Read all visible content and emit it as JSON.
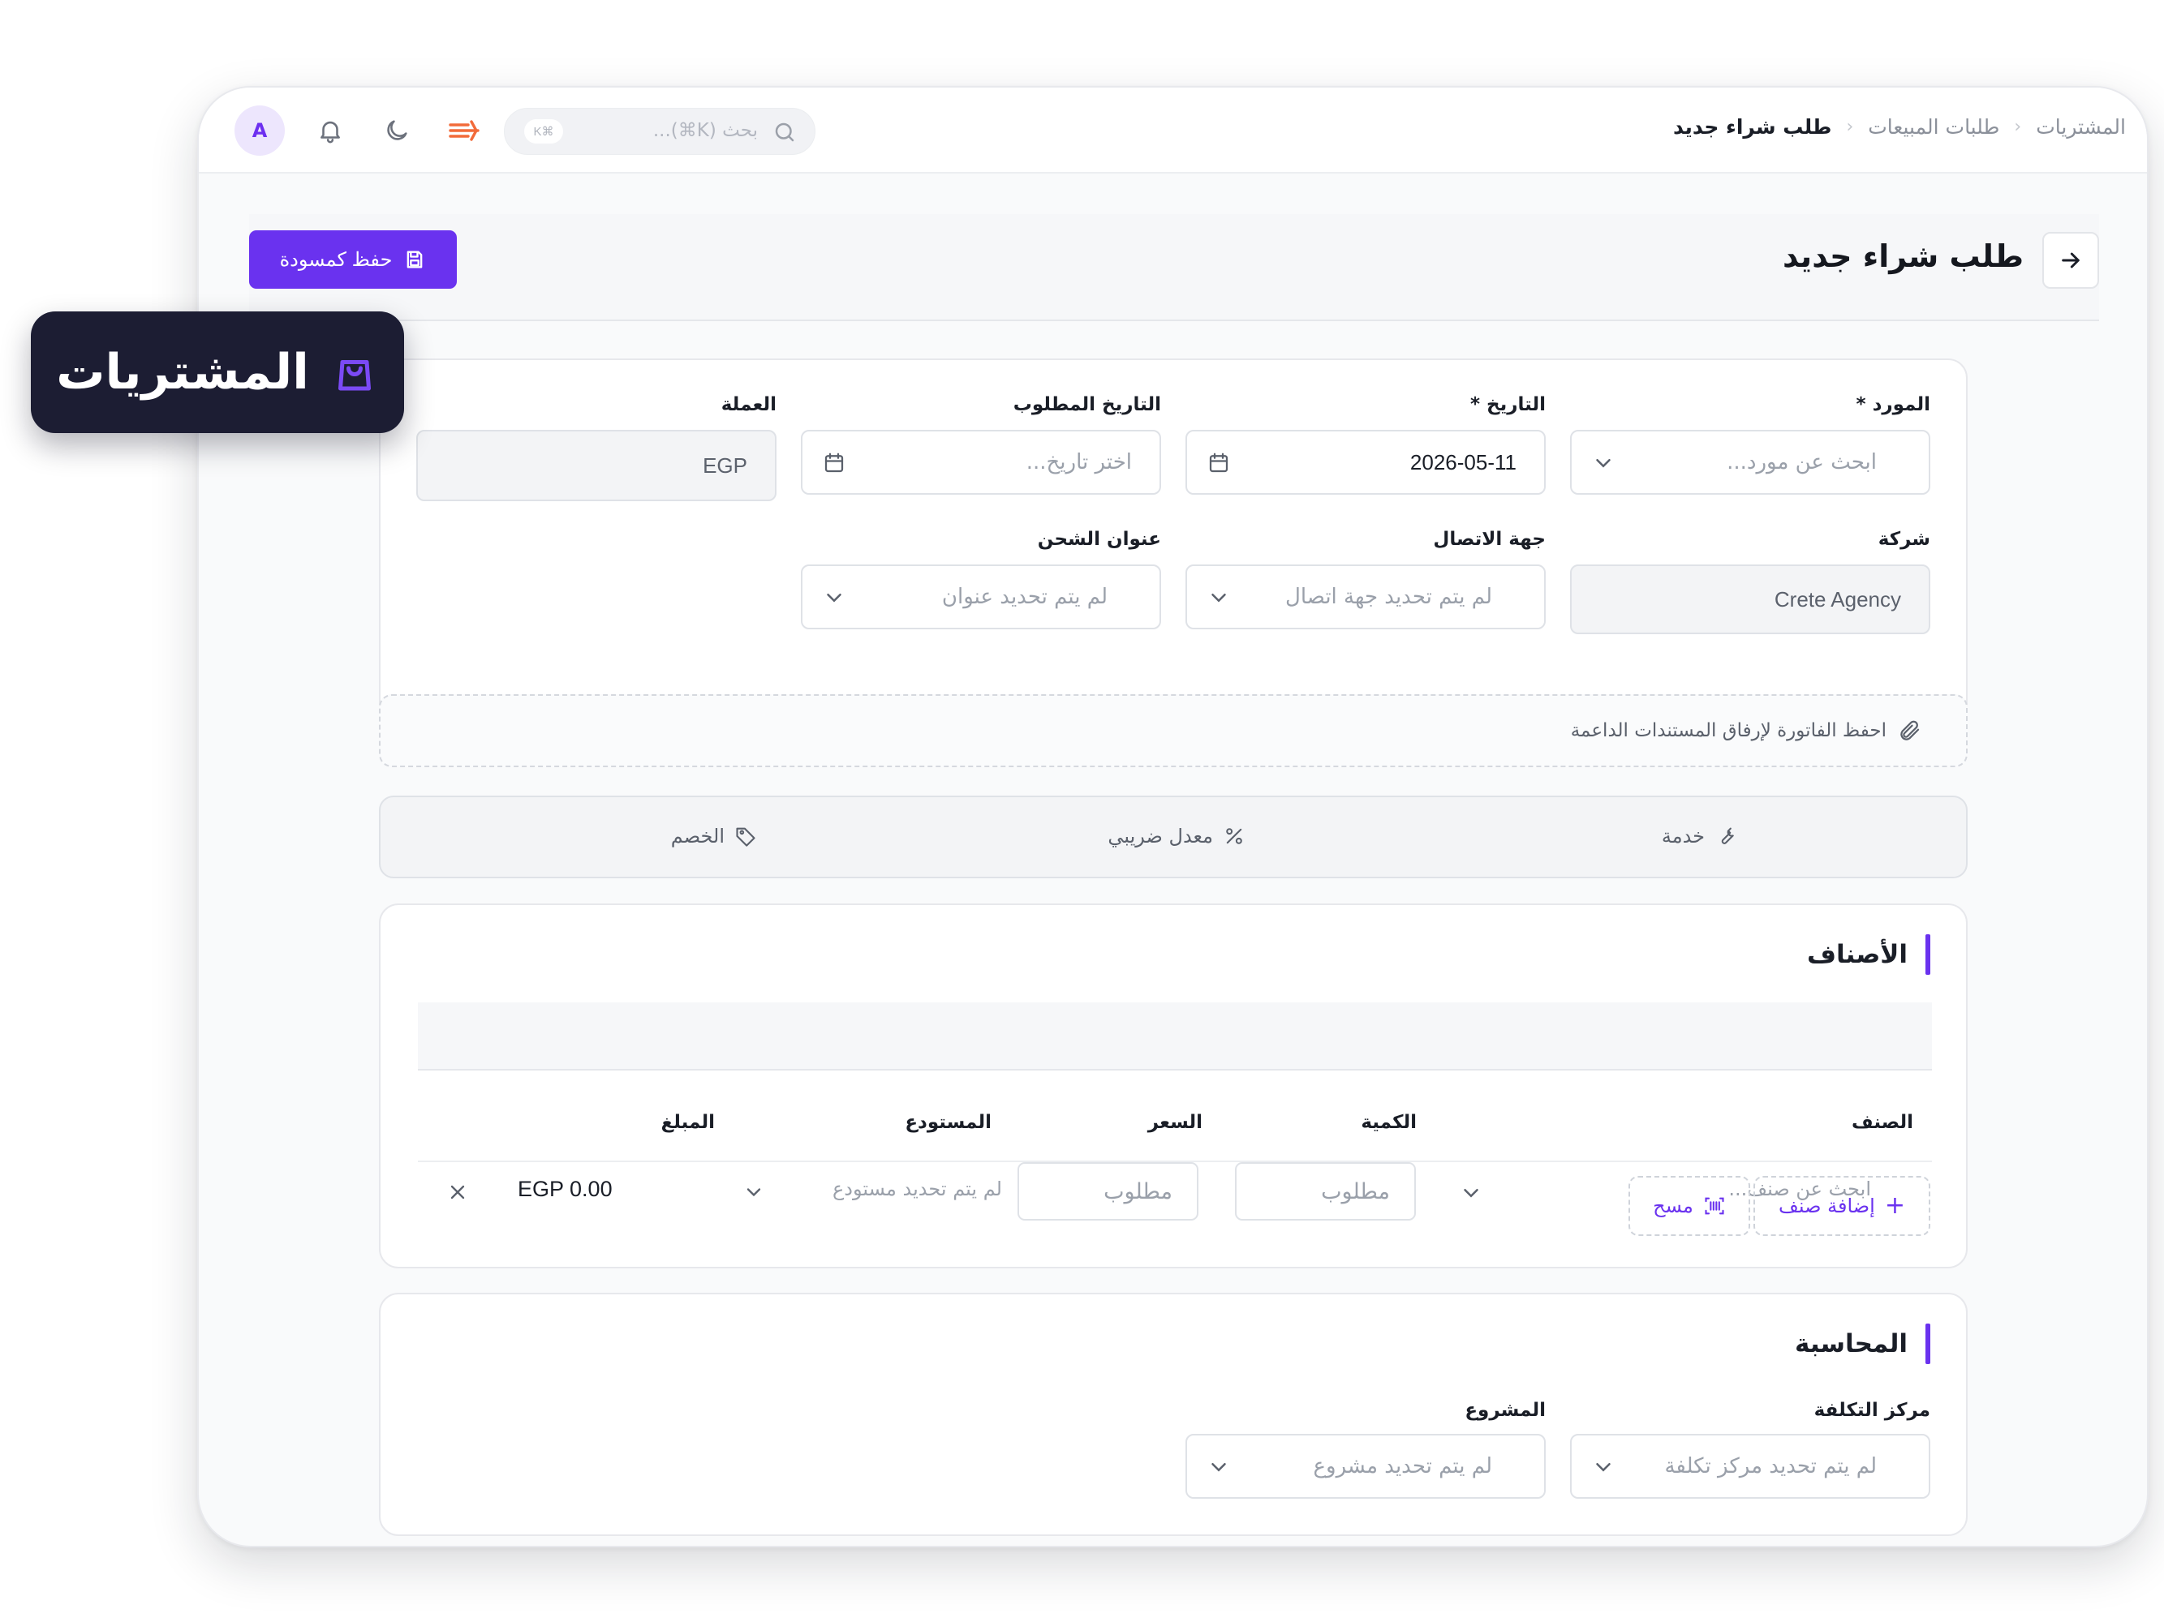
{
  "badge": {
    "label": "المشتريات",
    "icon": "shopping-bag-icon"
  },
  "topbar": {
    "avatar_initial": "A",
    "search_placeholder": "بحث (K⌘)...",
    "search_shortcut": "K⌘",
    "icons": [
      "search-icon",
      "bell-icon",
      "moon-icon",
      "brand-logo-icon"
    ]
  },
  "breadcrumb": {
    "items": [
      "المشتريات",
      "طلبات المبيعات"
    ],
    "current": "طلب شراء جديد"
  },
  "header": {
    "title": "طلب شراء جديد",
    "save_label": "حفظ كمسودة"
  },
  "form": {
    "supplier_label": "المورد *",
    "supplier_placeholder": "ابحث عن مورد...",
    "date_label": "التاريخ *",
    "date_value": "2026-05-11",
    "required_date_label": "التاريخ المطلوب",
    "required_date_placeholder": "اختر تاريخ...",
    "currency_label": "العملة",
    "currency_value": "EGP",
    "company_label": "شركة",
    "company_value": "Crete Agency",
    "contact_label": "جهة الاتصال",
    "contact_placeholder": "لم يتم تحديد جهة اتصال",
    "shipping_label": "عنوان الشحن",
    "shipping_placeholder": "لم يتم تحديد عنوان"
  },
  "attachment": {
    "text": "احفظ الفاتورة لإرفاق المستندات الداعمة"
  },
  "options": {
    "service": "خدمة",
    "tax_rate": "معدل ضريبي",
    "discount": "الخصم"
  },
  "items": {
    "title": "الأصناف",
    "columns": {
      "item": "الصنف",
      "quantity": "الكمية",
      "price": "السعر",
      "warehouse": "المستودع",
      "amount": "المبلغ"
    },
    "row": {
      "item_placeholder": "ابحث عن صنف...",
      "quantity_placeholder": "مطلوب",
      "price_placeholder": "مطلوب",
      "warehouse_placeholder": "لم يتم تحديد مستودع",
      "amount": "EGP 0.00"
    },
    "add_label": "إضافة صنف",
    "scan_label": "مسح"
  },
  "accounting": {
    "title": "المحاسبة",
    "cost_center_label": "مركز التكلفة",
    "cost_center_placeholder": "لم يتم تحديد مركز تكلفة",
    "project_label": "المشروع",
    "project_placeholder": "لم يتم تحديد مشروع"
  },
  "colors": {
    "accent": "#6a32ef",
    "badge_bg": "#1c1d33",
    "brand_logo": "#f26b3a"
  }
}
